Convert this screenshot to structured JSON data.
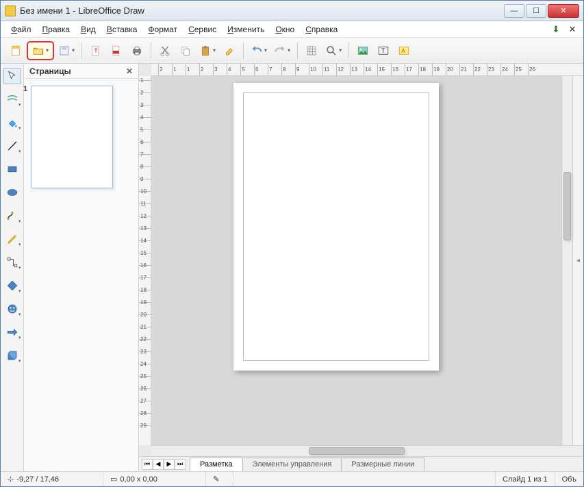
{
  "window": {
    "title": "Без имени 1 - LibreOffice Draw"
  },
  "menu": {
    "file": "Файл",
    "edit": "Правка",
    "view": "Вид",
    "insert": "Вставка",
    "format": "Формат",
    "tools": "Сервис",
    "modify": "Изменить",
    "window": "Окно",
    "help": "Справка"
  },
  "pages_panel": {
    "title": "Страницы",
    "page_number": "1"
  },
  "tabs": {
    "layout": "Разметка",
    "controls": "Элементы управления",
    "dimlines": "Размерные линии"
  },
  "status": {
    "coords": "-9,27 / 17,46",
    "size": "0,00 x 0,00",
    "slides": "Слайд 1 из 1",
    "obj": "Объ"
  },
  "ruler_h": [
    "2",
    "1",
    "1",
    "2",
    "3",
    "4",
    "5",
    "6",
    "7",
    "8",
    "9",
    "10",
    "11",
    "12",
    "13",
    "14",
    "15",
    "16",
    "17",
    "18",
    "19",
    "20",
    "21",
    "22",
    "23",
    "24",
    "25",
    "26"
  ],
  "ruler_v": [
    "1",
    "2",
    "3",
    "4",
    "5",
    "6",
    "7",
    "8",
    "9",
    "10",
    "11",
    "12",
    "13",
    "14",
    "15",
    "16",
    "17",
    "18",
    "19",
    "20",
    "21",
    "22",
    "23",
    "24",
    "25",
    "26",
    "27",
    "28",
    "29"
  ]
}
